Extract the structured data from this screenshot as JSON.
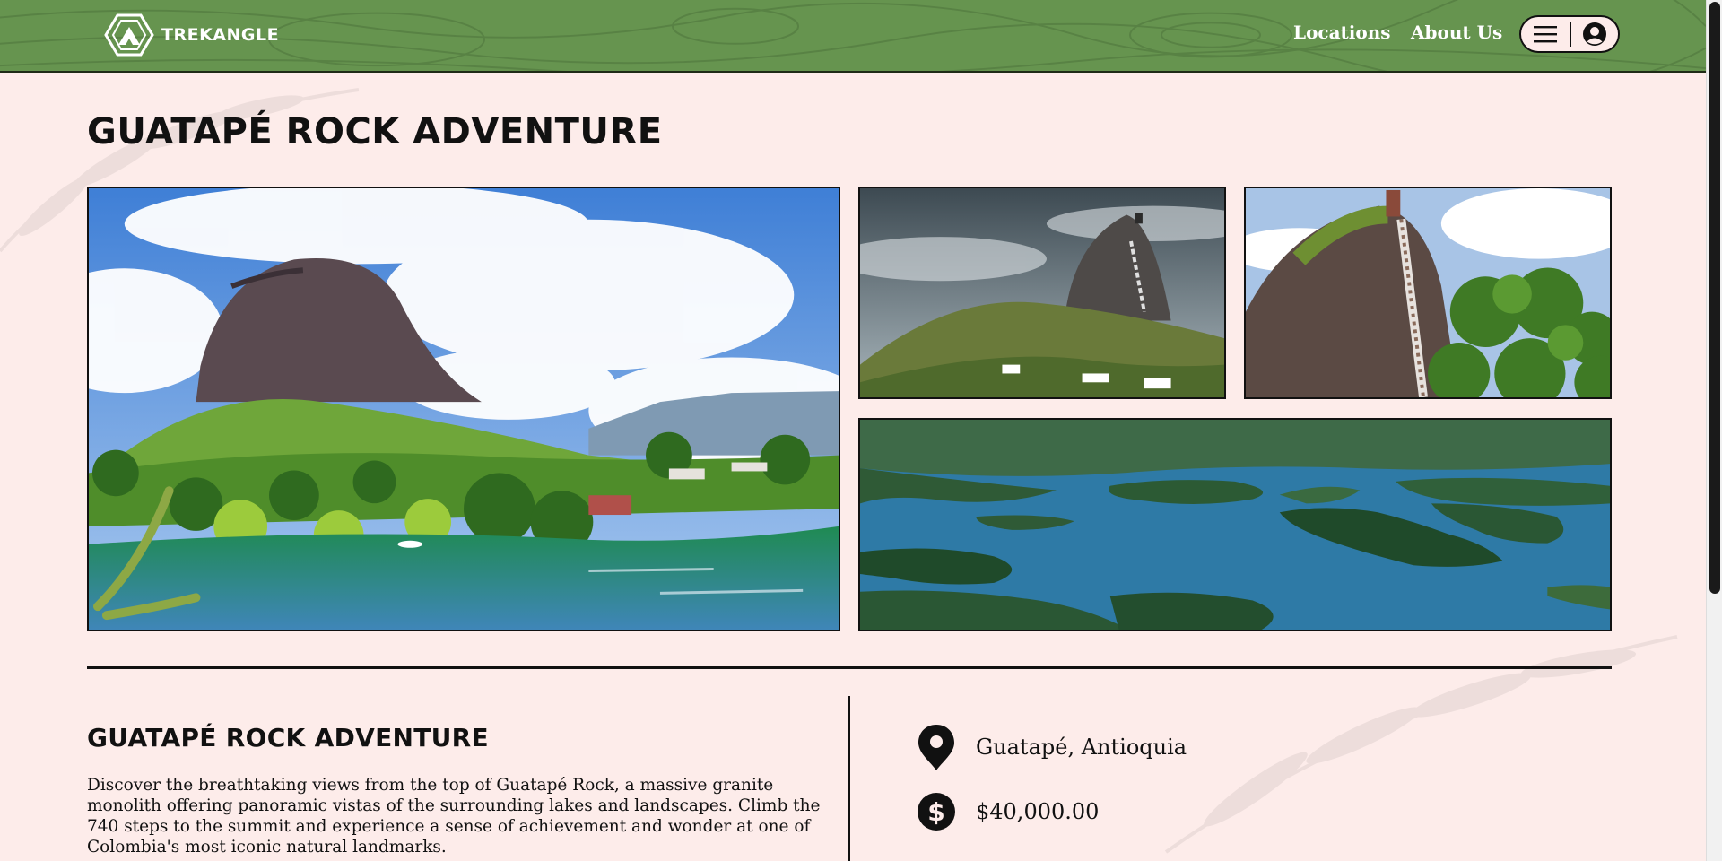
{
  "header": {
    "brand": "TREKANGLE",
    "nav": {
      "locations": "Locations",
      "about": "About Us"
    },
    "menu_icon": "hamburger-icon",
    "account_icon": "user-circle-icon",
    "background_color": "#66944f"
  },
  "page": {
    "title": "GUATAPÉ ROCK ADVENTURE",
    "background_color": "#fdecea"
  },
  "gallery": {
    "photos": [
      {
        "name": "main",
        "subject": "Guatapé rock above green hills and lake"
      },
      {
        "name": "a",
        "subject": "Guatapé rock under stormy sky"
      },
      {
        "name": "b",
        "subject": "Guatapé rock staircase close-up"
      },
      {
        "name": "c",
        "subject": "Aerial view of Guatapé reservoir islands"
      }
    ]
  },
  "detail": {
    "title": "GUATAPÉ ROCK ADVENTURE",
    "description": "Discover the breathtaking views from the top of Guatapé Rock, a massive granite monolith offering panoramic vistas of the surrounding lakes and landscapes. Climb the 740 steps to the summit and experience a sense of achievement and wonder at one of Colombia's most iconic natural landmarks.",
    "location": "Guatapé, Antioquia",
    "price": "$40,000.00",
    "location_icon": "map-pin-icon",
    "price_icon": "dollar-icon"
  }
}
